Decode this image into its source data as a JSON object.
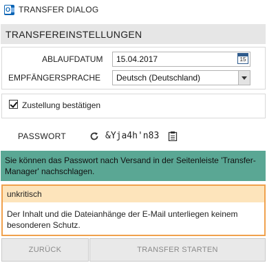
{
  "window": {
    "title": "TRANSFER DIALOG",
    "icon": "outlook-icon"
  },
  "section": {
    "header": "TRANSFEREINSTELLUNGEN"
  },
  "settings": {
    "expiry_label": "ABLAUFDATUM",
    "expiry_value": "15.04.2017",
    "calendar_day": "15",
    "language_label": "EMPFÄNGERSPRACHE",
    "language_value": "Deutsch (Deutschland)"
  },
  "confirm": {
    "label": "Zustellung bestätigen",
    "checked": true
  },
  "password": {
    "label": "PASSWORT",
    "value": "&Yja4h'n83",
    "refresh_icon": "refresh-icon",
    "copy_icon": "clipboard-icon"
  },
  "info": {
    "text": "Sie können das Passwort nach Versand in der Seitenleiste 'Transfer-Manager' nachschlagen.",
    "color": "#5aa794"
  },
  "warning": {
    "level": "unkritisch",
    "text": "Der Inhalt und die Dateianhänge der E-Mail unterliegen keinem besonderen Schutz.",
    "border_color": "#f0a04b",
    "header_color": "#fde4bb"
  },
  "buttons": {
    "back": "ZURÜCK",
    "start": "TRANSFER STARTEN"
  }
}
